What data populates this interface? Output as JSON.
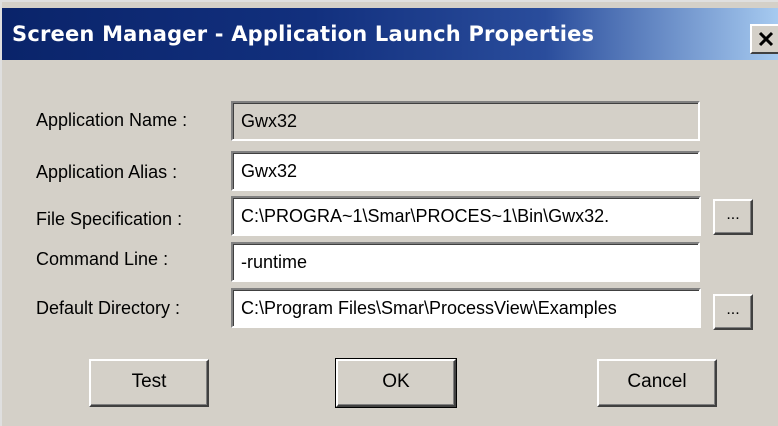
{
  "window": {
    "title": "Screen Manager - Application Launch Properties"
  },
  "fields": {
    "application_name": {
      "label": "Application Name :",
      "value": "Gwx32"
    },
    "application_alias": {
      "label": "Application Alias :",
      "value": "Gwx32"
    },
    "file_specification": {
      "label": "File Specification :",
      "value": "C:\\PROGRA~1\\Smar\\PROCES~1\\Bin\\Gwx32."
    },
    "command_line": {
      "label": "Command Line :",
      "value": "-runtime"
    },
    "default_directory": {
      "label": "Default Directory :",
      "value": "C:\\Program Files\\Smar\\ProcessView\\Examples"
    }
  },
  "buttons": {
    "browse": "...",
    "test": "Test",
    "ok": "OK",
    "cancel": "Cancel"
  },
  "icons": {
    "close": "close-icon"
  }
}
